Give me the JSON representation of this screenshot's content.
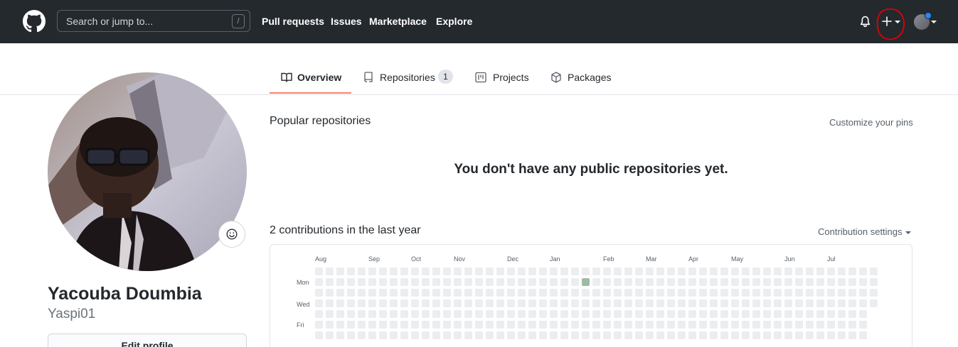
{
  "header": {
    "search_placeholder": "Search or jump to...",
    "search_shortcut": "/",
    "nav": [
      "Pull requests",
      "Issues",
      "Marketplace",
      "Explore"
    ]
  },
  "tabs": [
    {
      "label": "Overview",
      "icon": "book-icon",
      "active": true
    },
    {
      "label": "Repositories",
      "icon": "repo-icon",
      "count": "1"
    },
    {
      "label": "Projects",
      "icon": "project-icon"
    },
    {
      "label": "Packages",
      "icon": "package-icon"
    }
  ],
  "profile": {
    "full_name": "Yacouba Doumbia",
    "username": "Yaspi01",
    "edit_label": "Edit profile"
  },
  "popular": {
    "title": "Popular repositories",
    "customize_label": "Customize your pins",
    "empty_message": "You don't have any public repositories yet."
  },
  "contributions": {
    "title": "2 contributions in the last year",
    "settings_label": "Contribution settings",
    "months": [
      "Aug",
      "Sep",
      "Oct",
      "Nov",
      "Dec",
      "Jan",
      "Feb",
      "Mar",
      "Apr",
      "May",
      "Jun",
      "Jul"
    ],
    "day_labels": [
      "Mon",
      "Wed",
      "Fri"
    ]
  },
  "colors": {
    "header_bg": "#24292e",
    "active_tab_accent": "#f9826c",
    "empty_cell": "#ebedf0",
    "level1_cell": "#9be9a8",
    "annotation_red": "#e00000"
  }
}
